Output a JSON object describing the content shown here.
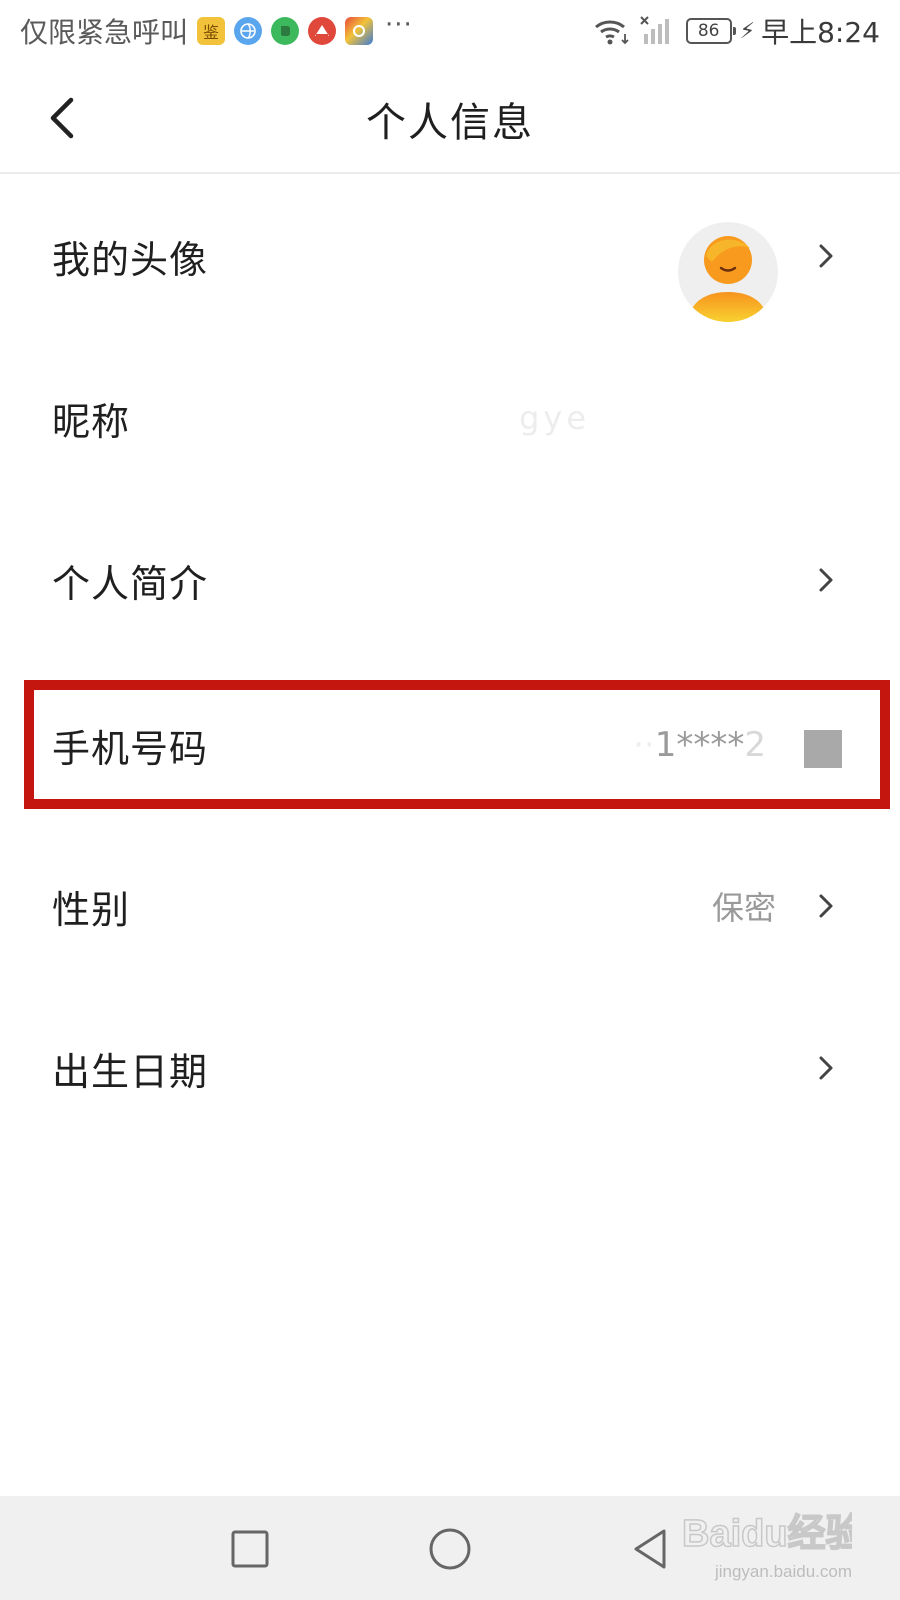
{
  "status_bar": {
    "carrier": "仅限紧急呼叫",
    "notification_icons": [
      {
        "name": "jian-app-icon",
        "color": "#f2c33a",
        "glyph": "鉴"
      },
      {
        "name": "browser-icon",
        "color": "#4a9be8",
        "glyph": ""
      },
      {
        "name": "evernote-icon",
        "color": "#3cb95d",
        "glyph": ""
      },
      {
        "name": "red-app-icon",
        "color": "#e0483c",
        "glyph": ""
      },
      {
        "name": "colorful-app-icon",
        "color": "#3a7bd5",
        "glyph": ""
      }
    ],
    "more": "···",
    "battery": "86",
    "time": "早上8:24"
  },
  "header": {
    "title": "个人信息"
  },
  "rows": [
    {
      "label": "我的头像"
    },
    {
      "label": "昵称",
      "value": "gye"
    },
    {
      "label": "个人简介"
    },
    {
      "label": "手机号码",
      "value_prefix": "1",
      "value_mask": "****",
      "value_suffix": "2"
    },
    {
      "label": "性别",
      "value": "保密"
    },
    {
      "label": "出生日期"
    }
  ],
  "colors": {
    "highlight": "#c4160f",
    "avatar_orange": "#f7a01e",
    "avatar_yellow": "#f8d12f"
  },
  "watermark": {
    "logo": "Baidu经验",
    "url": "jingyan.baidu.com"
  }
}
